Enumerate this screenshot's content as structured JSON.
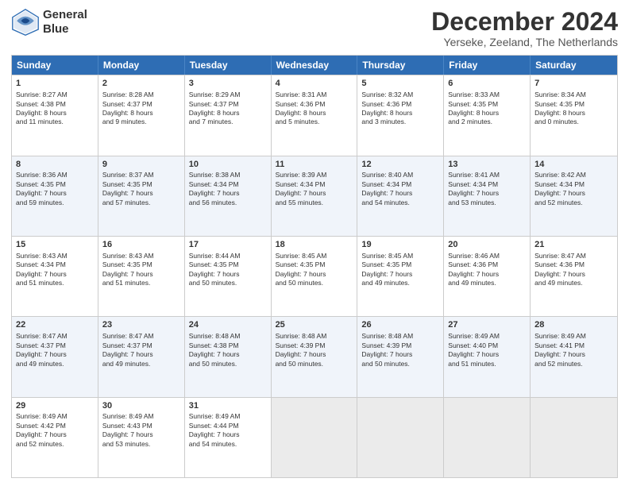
{
  "header": {
    "logo_line1": "General",
    "logo_line2": "Blue",
    "main_title": "December 2024",
    "subtitle": "Yerseke, Zeeland, The Netherlands"
  },
  "days": [
    "Sunday",
    "Monday",
    "Tuesday",
    "Wednesday",
    "Thursday",
    "Friday",
    "Saturday"
  ],
  "weeks": [
    [
      {
        "num": "1",
        "lines": [
          "Sunrise: 8:27 AM",
          "Sunset: 4:38 PM",
          "Daylight: 8 hours",
          "and 11 minutes."
        ]
      },
      {
        "num": "2",
        "lines": [
          "Sunrise: 8:28 AM",
          "Sunset: 4:37 PM",
          "Daylight: 8 hours",
          "and 9 minutes."
        ]
      },
      {
        "num": "3",
        "lines": [
          "Sunrise: 8:29 AM",
          "Sunset: 4:37 PM",
          "Daylight: 8 hours",
          "and 7 minutes."
        ]
      },
      {
        "num": "4",
        "lines": [
          "Sunrise: 8:31 AM",
          "Sunset: 4:36 PM",
          "Daylight: 8 hours",
          "and 5 minutes."
        ]
      },
      {
        "num": "5",
        "lines": [
          "Sunrise: 8:32 AM",
          "Sunset: 4:36 PM",
          "Daylight: 8 hours",
          "and 3 minutes."
        ]
      },
      {
        "num": "6",
        "lines": [
          "Sunrise: 8:33 AM",
          "Sunset: 4:35 PM",
          "Daylight: 8 hours",
          "and 2 minutes."
        ]
      },
      {
        "num": "7",
        "lines": [
          "Sunrise: 8:34 AM",
          "Sunset: 4:35 PM",
          "Daylight: 8 hours",
          "and 0 minutes."
        ]
      }
    ],
    [
      {
        "num": "8",
        "lines": [
          "Sunrise: 8:36 AM",
          "Sunset: 4:35 PM",
          "Daylight: 7 hours",
          "and 59 minutes."
        ]
      },
      {
        "num": "9",
        "lines": [
          "Sunrise: 8:37 AM",
          "Sunset: 4:35 PM",
          "Daylight: 7 hours",
          "and 57 minutes."
        ]
      },
      {
        "num": "10",
        "lines": [
          "Sunrise: 8:38 AM",
          "Sunset: 4:34 PM",
          "Daylight: 7 hours",
          "and 56 minutes."
        ]
      },
      {
        "num": "11",
        "lines": [
          "Sunrise: 8:39 AM",
          "Sunset: 4:34 PM",
          "Daylight: 7 hours",
          "and 55 minutes."
        ]
      },
      {
        "num": "12",
        "lines": [
          "Sunrise: 8:40 AM",
          "Sunset: 4:34 PM",
          "Daylight: 7 hours",
          "and 54 minutes."
        ]
      },
      {
        "num": "13",
        "lines": [
          "Sunrise: 8:41 AM",
          "Sunset: 4:34 PM",
          "Daylight: 7 hours",
          "and 53 minutes."
        ]
      },
      {
        "num": "14",
        "lines": [
          "Sunrise: 8:42 AM",
          "Sunset: 4:34 PM",
          "Daylight: 7 hours",
          "and 52 minutes."
        ]
      }
    ],
    [
      {
        "num": "15",
        "lines": [
          "Sunrise: 8:43 AM",
          "Sunset: 4:34 PM",
          "Daylight: 7 hours",
          "and 51 minutes."
        ]
      },
      {
        "num": "16",
        "lines": [
          "Sunrise: 8:43 AM",
          "Sunset: 4:35 PM",
          "Daylight: 7 hours",
          "and 51 minutes."
        ]
      },
      {
        "num": "17",
        "lines": [
          "Sunrise: 8:44 AM",
          "Sunset: 4:35 PM",
          "Daylight: 7 hours",
          "and 50 minutes."
        ]
      },
      {
        "num": "18",
        "lines": [
          "Sunrise: 8:45 AM",
          "Sunset: 4:35 PM",
          "Daylight: 7 hours",
          "and 50 minutes."
        ]
      },
      {
        "num": "19",
        "lines": [
          "Sunrise: 8:45 AM",
          "Sunset: 4:35 PM",
          "Daylight: 7 hours",
          "and 49 minutes."
        ]
      },
      {
        "num": "20",
        "lines": [
          "Sunrise: 8:46 AM",
          "Sunset: 4:36 PM",
          "Daylight: 7 hours",
          "and 49 minutes."
        ]
      },
      {
        "num": "21",
        "lines": [
          "Sunrise: 8:47 AM",
          "Sunset: 4:36 PM",
          "Daylight: 7 hours",
          "and 49 minutes."
        ]
      }
    ],
    [
      {
        "num": "22",
        "lines": [
          "Sunrise: 8:47 AM",
          "Sunset: 4:37 PM",
          "Daylight: 7 hours",
          "and 49 minutes."
        ]
      },
      {
        "num": "23",
        "lines": [
          "Sunrise: 8:47 AM",
          "Sunset: 4:37 PM",
          "Daylight: 7 hours",
          "and 49 minutes."
        ]
      },
      {
        "num": "24",
        "lines": [
          "Sunrise: 8:48 AM",
          "Sunset: 4:38 PM",
          "Daylight: 7 hours",
          "and 50 minutes."
        ]
      },
      {
        "num": "25",
        "lines": [
          "Sunrise: 8:48 AM",
          "Sunset: 4:39 PM",
          "Daylight: 7 hours",
          "and 50 minutes."
        ]
      },
      {
        "num": "26",
        "lines": [
          "Sunrise: 8:48 AM",
          "Sunset: 4:39 PM",
          "Daylight: 7 hours",
          "and 50 minutes."
        ]
      },
      {
        "num": "27",
        "lines": [
          "Sunrise: 8:49 AM",
          "Sunset: 4:40 PM",
          "Daylight: 7 hours",
          "and 51 minutes."
        ]
      },
      {
        "num": "28",
        "lines": [
          "Sunrise: 8:49 AM",
          "Sunset: 4:41 PM",
          "Daylight: 7 hours",
          "and 52 minutes."
        ]
      }
    ],
    [
      {
        "num": "29",
        "lines": [
          "Sunrise: 8:49 AM",
          "Sunset: 4:42 PM",
          "Daylight: 7 hours",
          "and 52 minutes."
        ]
      },
      {
        "num": "30",
        "lines": [
          "Sunrise: 8:49 AM",
          "Sunset: 4:43 PM",
          "Daylight: 7 hours",
          "and 53 minutes."
        ]
      },
      {
        "num": "31",
        "lines": [
          "Sunrise: 8:49 AM",
          "Sunset: 4:44 PM",
          "Daylight: 7 hours",
          "and 54 minutes."
        ]
      },
      {
        "num": "",
        "lines": []
      },
      {
        "num": "",
        "lines": []
      },
      {
        "num": "",
        "lines": []
      },
      {
        "num": "",
        "lines": []
      }
    ]
  ]
}
